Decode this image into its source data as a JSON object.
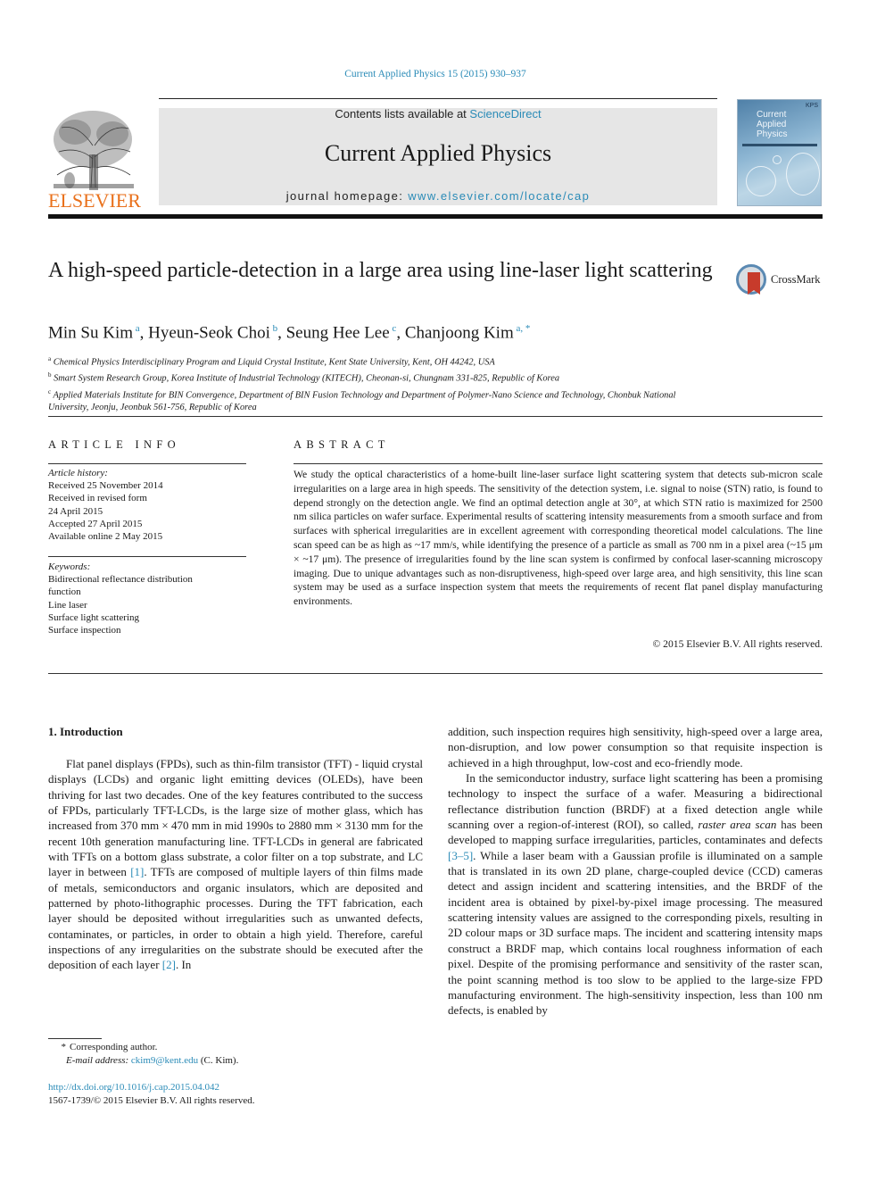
{
  "header": {
    "citation": "Current Applied Physics 15 (2015) 930–937",
    "publisher_logo_text": "ELSEVIER",
    "contents_prefix": "Contents lists available at ",
    "contents_link": "ScienceDirect",
    "journal_name": "Current Applied Physics",
    "homepage_prefix": "journal homepage: ",
    "homepage_link": "www.elsevier.com/locate/cap",
    "cover": {
      "title_line1": "Current",
      "title_line2": "Applied",
      "title_line3": "Physics",
      "badge": "KPS"
    }
  },
  "article": {
    "title": "A high-speed particle-detection in a large area using line-laser light scattering",
    "crossmark_label": "CrossMark",
    "authors": [
      {
        "name": "Min Su Kim",
        "sup": "a",
        "sep": ", "
      },
      {
        "name": "Hyeun-Seok Choi",
        "sup": "b",
        "sep": ", "
      },
      {
        "name": "Seung Hee Lee",
        "sup": "c",
        "sep": ", "
      },
      {
        "name": "Chanjoong Kim",
        "sup": "a, *",
        "sep": ""
      }
    ],
    "affiliations": [
      {
        "sup": "a",
        "text": "Chemical Physics Interdisciplinary Program and Liquid Crystal Institute, Kent State University, Kent, OH 44242, USA"
      },
      {
        "sup": "b",
        "text": "Smart System Research Group, Korea Institute of Industrial Technology (KITECH), Cheonan-si, Chungnam 331-825, Republic of Korea"
      },
      {
        "sup": "c",
        "text": "Applied Materials Institute for BIN Convergence, Department of BIN Fusion Technology and Department of Polymer-Nano Science and Technology, Chonbuk National University, Jeonju, Jeonbuk 561-756, Republic of Korea"
      }
    ]
  },
  "article_info": {
    "heading": "ARTICLE INFO",
    "history_label": "Article history:",
    "history": [
      "Received 25 November 2014",
      "Received in revised form",
      "24 April 2015",
      "Accepted 27 April 2015",
      "Available online 2 May 2015"
    ],
    "keywords_label": "Keywords:",
    "keywords": [
      "Bidirectional reflectance distribution function",
      "Line laser",
      "Surface light scattering",
      "Surface inspection"
    ]
  },
  "abstract": {
    "heading": "ABSTRACT",
    "text": "We study the optical characteristics of a home-built line-laser surface light scattering system that detects sub-micron scale irregularities on a large area in high speeds. The sensitivity of the detection system, i.e. signal to noise (STN) ratio, is found to depend strongly on the detection angle. We find an optimal detection angle at 30°, at which STN ratio is maximized for 2500 nm silica particles on wafer surface. Experimental results of scattering intensity measurements from a smooth surface and from surfaces with spherical irregularities are in excellent agreement with corresponding theoretical model calculations. The line scan speed can be as high as ~17 mm/s, while identifying the presence of a particle as small as 700 nm in a pixel area (~15 μm × ~17 μm). The presence of irregularities found by the line scan system is confirmed by confocal laser-scanning microscopy imaging. Due to unique advantages such as non-disruptiveness, high-speed over large area, and high sensitivity, this line scan system may be used as a surface inspection system that meets the requirements of recent flat panel display manufacturing environments.",
    "copyright": "© 2015 Elsevier B.V. All rights reserved."
  },
  "body": {
    "section_heading": "1.  Introduction",
    "left": {
      "p1_a": "Flat panel displays (FPDs), such as thin-film transistor (TFT) - liquid crystal displays (LCDs) and organic light emitting devices (OLEDs), have been thriving for last two decades. One of the key features contributed to the success of FPDs, particularly TFT-LCDs, is the large size of mother glass, which has increased from 370 mm × 470 mm in mid 1990s to 2880 mm × 3130 mm for the recent 10th generation manufacturing line. TFT-LCDs in general are fabricated with TFTs on a bottom glass substrate, a color filter on a top substrate, and LC layer in between ",
      "ref1": "[1]",
      "p1_b": ". TFTs are composed of multiple layers of thin films made of metals, semiconductors and organic insulators, which are deposited and patterned by photo-lithographic processes. During the TFT fabrication, each layer should be deposited without irregularities such as unwanted defects, contaminates, or particles, in order to obtain a high yield. Therefore, careful inspections of any irregularities on the substrate should be executed after the deposition of each layer ",
      "ref2": "[2]",
      "p1_c": ". In"
    },
    "right": {
      "p1": "addition, such inspection requires high sensitivity, high-speed over a large area, non-disruption, and low power consumption so that requisite inspection is achieved in a high throughput, low-cost and eco-friendly mode.",
      "p2_a": "In the semiconductor industry, surface light scattering has been a promising technology to inspect the surface of a wafer. Measuring a bidirectional reflectance distribution function (BRDF) at a fixed detection angle while scanning over a region-of-interest (ROI), so called, ",
      "p2_em": "raster area scan",
      "p2_b": " has been developed to mapping surface irregularities, particles, contaminates and defects ",
      "ref3": "[3–5]",
      "p2_c": ". While a laser beam with a Gaussian profile is illuminated on a sample that is translated in its own 2D plane, charge-coupled device (CCD) cameras detect and assign incident and scattering intensities, and the BRDF of the incident area is obtained by pixel-by-pixel image processing. The measured scattering intensity values are assigned to the corresponding pixels, resulting in 2D colour maps or 3D surface maps. The incident and scattering intensity maps construct a BRDF map, which contains local roughness information of each pixel. Despite of the promising performance and sensitivity of the raster scan, the point scanning method is too slow to be applied to the large-size FPD manufacturing environment. The high-sensitivity inspection, less than 100 nm defects, is enabled by"
    }
  },
  "footer": {
    "star": "*",
    "corresponding": "Corresponding author.",
    "email_label": "E-mail address: ",
    "email": "ckim9@kent.edu",
    "email_suffix": " (C. Kim).",
    "doi": "http://dx.doi.org/10.1016/j.cap.2015.04.042",
    "issn_line": "1567-1739/© 2015 Elsevier B.V. All rights reserved."
  },
  "colors": {
    "link": "#2a8bb7",
    "elsevier_orange": "#e9711c",
    "banner_gray": "#e6e6e6"
  }
}
